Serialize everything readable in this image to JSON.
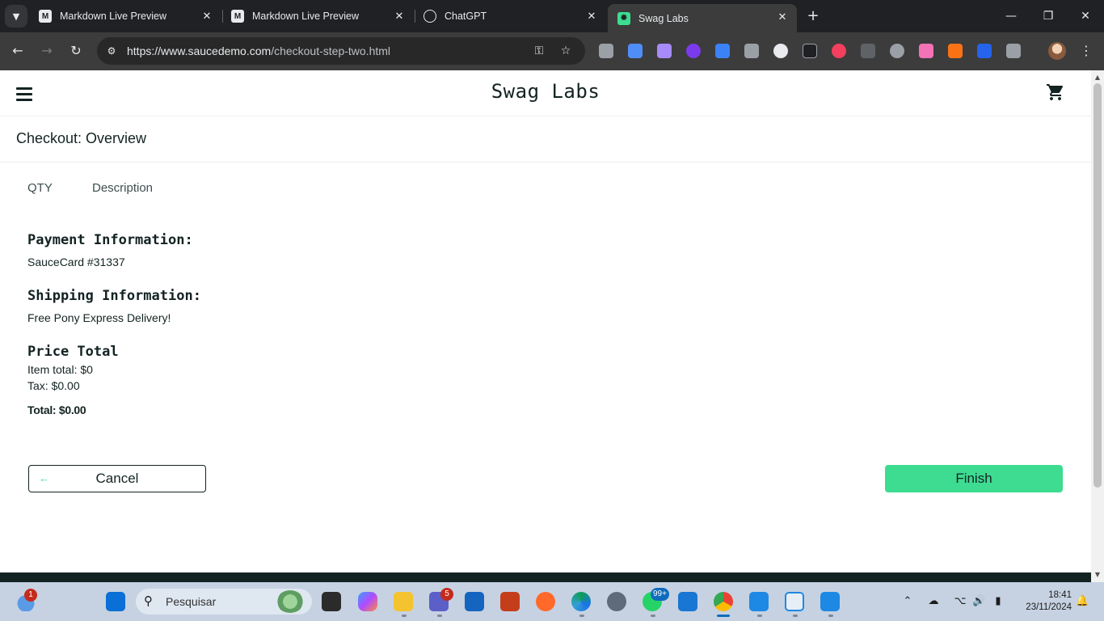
{
  "browser": {
    "tabs": [
      {
        "title": "Markdown Live Preview",
        "favicon": "markdown-m-icon"
      },
      {
        "title": "Markdown Live Preview",
        "favicon": "markdown-m-icon"
      },
      {
        "title": "ChatGPT",
        "favicon": "openai-icon"
      },
      {
        "title": "Swag Labs",
        "favicon": "swag-labs-icon",
        "active": true
      }
    ],
    "url_host": "https://www.saucedemo.com",
    "url_path": "/checkout-step-two.html"
  },
  "header": {
    "logo": "Swag Labs"
  },
  "page": {
    "title": "Checkout: Overview",
    "qty_label": "QTY",
    "description_label": "Description",
    "payment_label": "Payment Information:",
    "payment_value": "SauceCard #31337",
    "shipping_label": "Shipping Information:",
    "shipping_value": "Free Pony Express Delivery!",
    "price_label": "Price Total",
    "item_total": "Item total: $0",
    "tax": "Tax: $0.00",
    "total": "Total: $0.00",
    "cancel_label": "Cancel",
    "finish_label": "Finish"
  },
  "colors": {
    "accent_green": "#3ddc91",
    "text_dark": "#132322"
  },
  "taskbar": {
    "search_placeholder": "Pesquisar",
    "weather_badge": "1",
    "teams_badge": "5",
    "whatsapp_badge": "99+",
    "time": "18:41",
    "date": "23/11/2024"
  }
}
